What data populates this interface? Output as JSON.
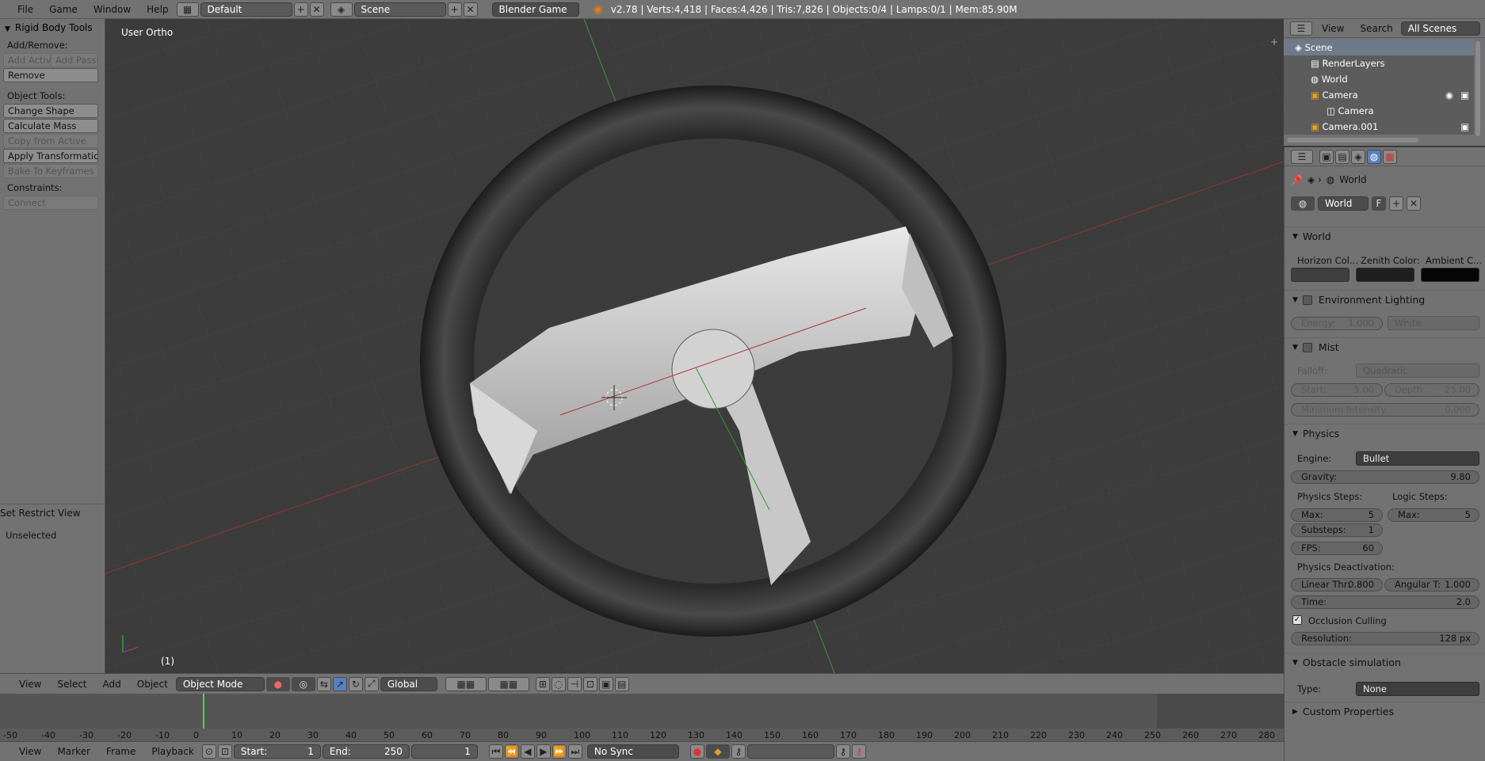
{
  "topbar": {
    "menus": [
      "File",
      "Game",
      "Window",
      "Help"
    ],
    "layout": "Default",
    "scene": "Scene",
    "engine": "Blender Game",
    "stats": "v2.78 | Verts:4,418 | Faces:4,426 | Tris:7,826 | Objects:0/4 | Lamps:0/1 | Mem:85.90M"
  },
  "toolshelf": {
    "title": "Rigid Body Tools",
    "add_remove": "Add/Remove:",
    "add_active": "Add Activ",
    "add_passive": "Add Passiv",
    "remove": "Remove",
    "object_tools": "Object Tools:",
    "change_shape": "Change Shape",
    "calculate_mass": "Calculate Mass",
    "copy_from_active": "Copy from Active",
    "apply_transformation": "Apply Transformation",
    "bake_to_keyframes": "Bake To Keyframes",
    "constraints": "Constraints:",
    "connect": "Connect",
    "restrict_title": "Set Restrict View",
    "unselected": "Unselected"
  },
  "viewport": {
    "label": "User Ortho",
    "frame": "(1)"
  },
  "view3d_header": {
    "menus": [
      "View",
      "Select",
      "Add",
      "Object"
    ],
    "mode": "Object Mode",
    "orientation": "Global"
  },
  "timeline": {
    "ticks": [
      "-50",
      "-40",
      "-30",
      "-20",
      "-10",
      "0",
      "10",
      "20",
      "30",
      "40",
      "50",
      "60",
      "70",
      "80",
      "90",
      "100",
      "110",
      "120",
      "130",
      "140",
      "150",
      "160",
      "170",
      "180",
      "190",
      "200",
      "210",
      "220",
      "230",
      "240",
      "250",
      "260",
      "270",
      "280"
    ],
    "menus": [
      "View",
      "Marker",
      "Frame",
      "Playback"
    ],
    "start_label": "Start:",
    "start_value": "1",
    "end_label": "End:",
    "end_value": "250",
    "current_frame": "1",
    "sync": "No Sync"
  },
  "outliner": {
    "menus": [
      "View",
      "Search"
    ],
    "filter": "All Scenes",
    "items": [
      "Scene",
      "RenderLayers",
      "World",
      "Camera",
      "Camera",
      "Camera.001"
    ]
  },
  "properties": {
    "breadcrumb": "World",
    "world_name": "World",
    "fake_user": "F",
    "world_panel": "World",
    "horizon_label": "Horizon Col...",
    "zenith_label": "Zenith Color:",
    "ambient_label": "Ambient C...",
    "horizon_color": "#3f3f3f",
    "zenith_color": "#1f1f1f",
    "ambient_color": "#050505",
    "env_panel": "Environment Lighting",
    "energy_label": "Energy:",
    "energy_value": "1.000",
    "env_color": "White",
    "mist_panel": "Mist",
    "falloff_label": "Falloff:",
    "falloff_value": "Quadratic",
    "start_label": "Start:",
    "start_value": "5.00",
    "depth_label": "Depth:",
    "depth_value": "25.00",
    "min_int_label": "Minimum Intensity:",
    "min_int_value": "0.000",
    "physics_panel": "Physics",
    "engine_label": "Engine:",
    "engine_value": "Bullet",
    "gravity_label": "Gravity:",
    "gravity_value": "9.80",
    "physics_steps": "Physics Steps:",
    "logic_steps": "Logic Steps:",
    "max_label": "Max:",
    "max_value": "5",
    "logic_max_label": "Max:",
    "logic_max_value": "5",
    "substeps_label": "Substeps:",
    "substeps_value": "1",
    "fps_label": "FPS:",
    "fps_value": "60",
    "deactivation": "Physics Deactivation:",
    "linear_label": "Linear Thr:",
    "linear_value": "0.800",
    "angular_label": "Angular T:",
    "angular_value": "1.000",
    "time_label": "Time:",
    "time_value": "2.0",
    "occlusion": "Occlusion Culling",
    "resolution_label": "Resolution:",
    "resolution_value": "128 px",
    "obstacle_panel": "Obstacle simulation",
    "type_label": "Type:",
    "type_value": "None",
    "custom_panel": "Custom Properties"
  }
}
